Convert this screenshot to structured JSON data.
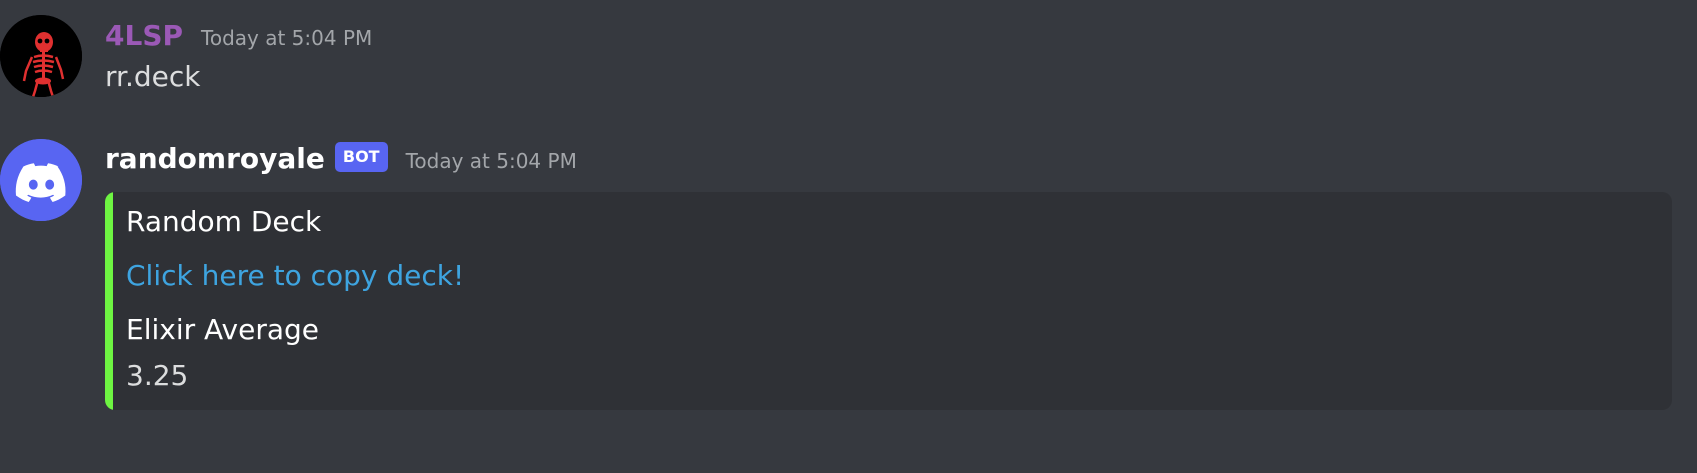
{
  "messages": [
    {
      "avatar_icon": "skeleton-icon",
      "author": "4LSP",
      "author_color": "#9b59b6",
      "timestamp": "Today at 5:04 PM",
      "content": "rr.deck"
    },
    {
      "avatar_icon": "discord-logo-icon",
      "author": "randomroyale",
      "author_color": "#ffffff",
      "bot_tag": "BOT",
      "timestamp": "Today at 5:04 PM",
      "embed": {
        "accent_color": "#6ef542",
        "title": "Random Deck",
        "link_text": "Click here to copy deck!",
        "fields": [
          {
            "name": "Elixir Average",
            "value": "3.25"
          }
        ]
      }
    }
  ]
}
